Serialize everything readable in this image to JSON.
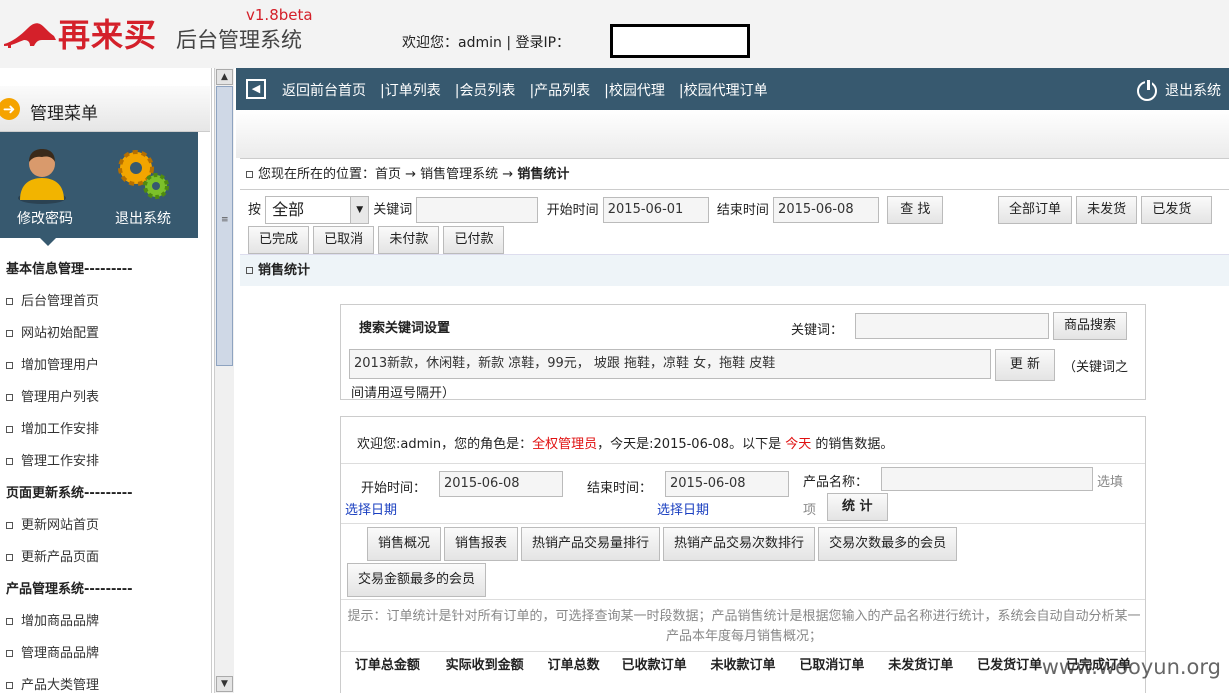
{
  "header": {
    "brand": "再来买",
    "subtitle": "后台管理系统",
    "version": "v1.8beta",
    "welcome": "欢迎您：admin   |   登录IP："
  },
  "sidebar": {
    "menu_title": "管理菜单",
    "shortcuts": [
      {
        "label": "修改密码",
        "icon": "user-icon"
      },
      {
        "label": "退出系统",
        "icon": "gears-icon"
      }
    ],
    "items": [
      {
        "type": "group",
        "label": "基本信息管理---------"
      },
      {
        "type": "item",
        "label": "后台管理首页"
      },
      {
        "type": "item",
        "label": "网站初始配置"
      },
      {
        "type": "item",
        "label": "增加管理用户"
      },
      {
        "type": "item",
        "label": "管理用户列表"
      },
      {
        "type": "item",
        "label": "增加工作安排"
      },
      {
        "type": "item",
        "label": "管理工作安排"
      },
      {
        "type": "group",
        "label": "页面更新系统---------"
      },
      {
        "type": "item",
        "label": "更新网站首页"
      },
      {
        "type": "item",
        "label": "更新产品页面"
      },
      {
        "type": "group",
        "label": "产品管理系统---------"
      },
      {
        "type": "item",
        "label": "增加商品品牌"
      },
      {
        "type": "item",
        "label": "管理商品品牌"
      },
      {
        "type": "item",
        "label": "产品大类管理"
      }
    ]
  },
  "navbar": {
    "links": [
      "返回前台首页",
      "订单列表",
      "会员列表",
      "产品列表",
      "校园代理",
      "校园代理订单"
    ],
    "separator": "|",
    "logout": "退出系统"
  },
  "location": {
    "prefix": "您现在所在的位置：首页 → 销售管理系统 → ",
    "current": "销售统计"
  },
  "filter": {
    "by_label": "按",
    "select_value": "全部",
    "keyword_label": "关键词",
    "start_label": "开始时间",
    "start_value": "2015-06-01",
    "end_label": "结束时间",
    "end_value": "2015-06-08",
    "search_btn": "查 找",
    "right_btns": [
      "全部订单",
      "未发货",
      "已发货"
    ],
    "row2_btns": [
      "已完成",
      "已取消",
      "未付款",
      "已付款"
    ]
  },
  "section_title": "销售统计",
  "keyword_box": {
    "title": "搜索关键词设置",
    "keyword_label": "关键词：",
    "search_btn": "商品搜索",
    "keywords": "2013新款，休闲鞋，新款 凉鞋，99元， 坡跟 拖鞋，凉鞋 女，拖鞋 皮鞋",
    "update_btn": "更 新",
    "hint_a": "（关键词之",
    "hint_b": "间请用逗号隔开）"
  },
  "stats_box": {
    "greet_a": "欢迎您:admin，您的角色是：",
    "role": "全权管理员",
    "greet_b": "，今天是:2015-06-08。以下是 ",
    "today": "今天",
    "greet_c": " 的销售数据。",
    "start_label": "开始时间：",
    "start_value": "2015-06-08",
    "start_pick": "选择日期",
    "end_label": "结束时间：",
    "end_value": "2015-06-08",
    "end_pick": "选择日期",
    "product_label": "产品名称：",
    "hint_a": "选填",
    "hint_b": "项",
    "stat_btn": "统 计",
    "tabs_row1": [
      "销售概况",
      "销售报表",
      "热销产品交易量排行",
      "热销产品交易次数排行",
      "交易次数最多的会员"
    ],
    "tabs_row2": [
      "交易金额最多的会员"
    ],
    "tip": "提示：订单统计是针对所有订单的，可选择查询某一时段数据；产品销售统计是根据您输入的产品名称进行统计，系统会自动自动分析某一产品本年度每月销售概况；",
    "columns": [
      "订单总金额",
      "实际收到金额",
      "订单总数",
      "已收款订单",
      "未收款订单",
      "已取消订单",
      "未发货订单",
      "已发货订单",
      "已完成订单"
    ]
  },
  "watermark": "www.wooyun.org"
}
